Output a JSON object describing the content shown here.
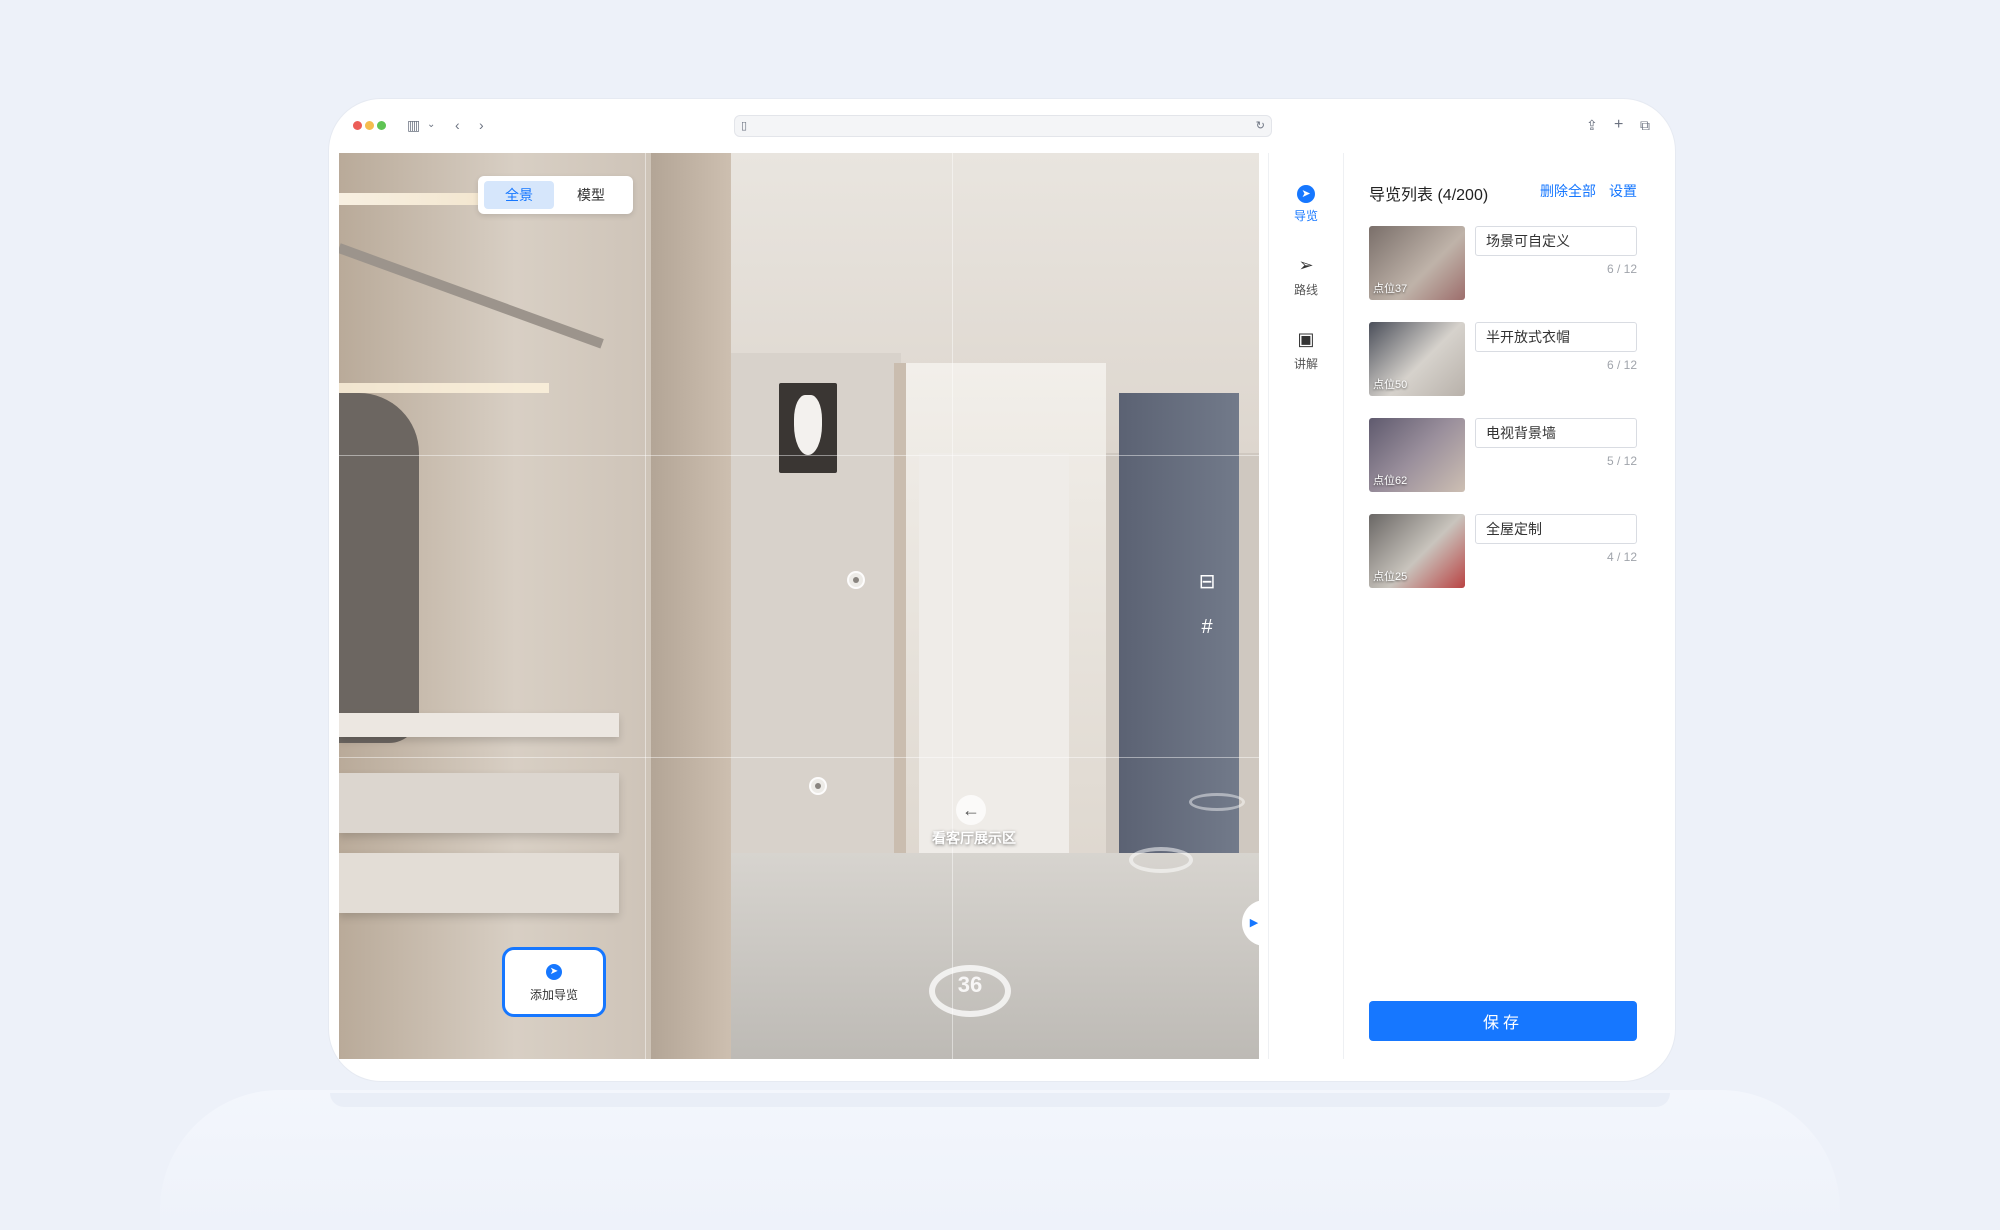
{
  "browser": {
    "left_icons": [
      "sidebar-icon",
      "chevron-down-icon",
      "back-icon",
      "forward-icon"
    ],
    "right_icons": [
      "share-icon",
      "new-tab-icon",
      "tabs-overview-icon"
    ]
  },
  "viewer": {
    "view_mode": {
      "active": "全景",
      "other": "模型"
    },
    "nav_label": "看客厅展示区",
    "floor_mark_text": "36",
    "add_guide_label": "添加导览"
  },
  "panel": {
    "tabs": [
      {
        "label": "导览",
        "icon": "compass-icon",
        "active": true
      },
      {
        "label": "路线",
        "icon": "send-icon",
        "active": false
      },
      {
        "label": "讲解",
        "icon": "video-icon",
        "active": false
      }
    ],
    "title": "导览列表",
    "title_count": "(4/200)",
    "delete_all": "删除全部",
    "settings": "设置",
    "items": [
      {
        "thumb_label": "点位37",
        "name": "场景可自定义",
        "count": "6 / 12"
      },
      {
        "thumb_label": "点位50",
        "name": "半开放式衣帽",
        "count": "6 / 12"
      },
      {
        "thumb_label": "点位62",
        "name": "电视背景墙",
        "count": "5 / 12"
      },
      {
        "thumb_label": "点位25",
        "name": "全屋定制",
        "count": "4 / 12"
      }
    ],
    "save_label": "保存"
  },
  "colors": {
    "accent": "#1677ff",
    "background": "#edf1f9"
  }
}
